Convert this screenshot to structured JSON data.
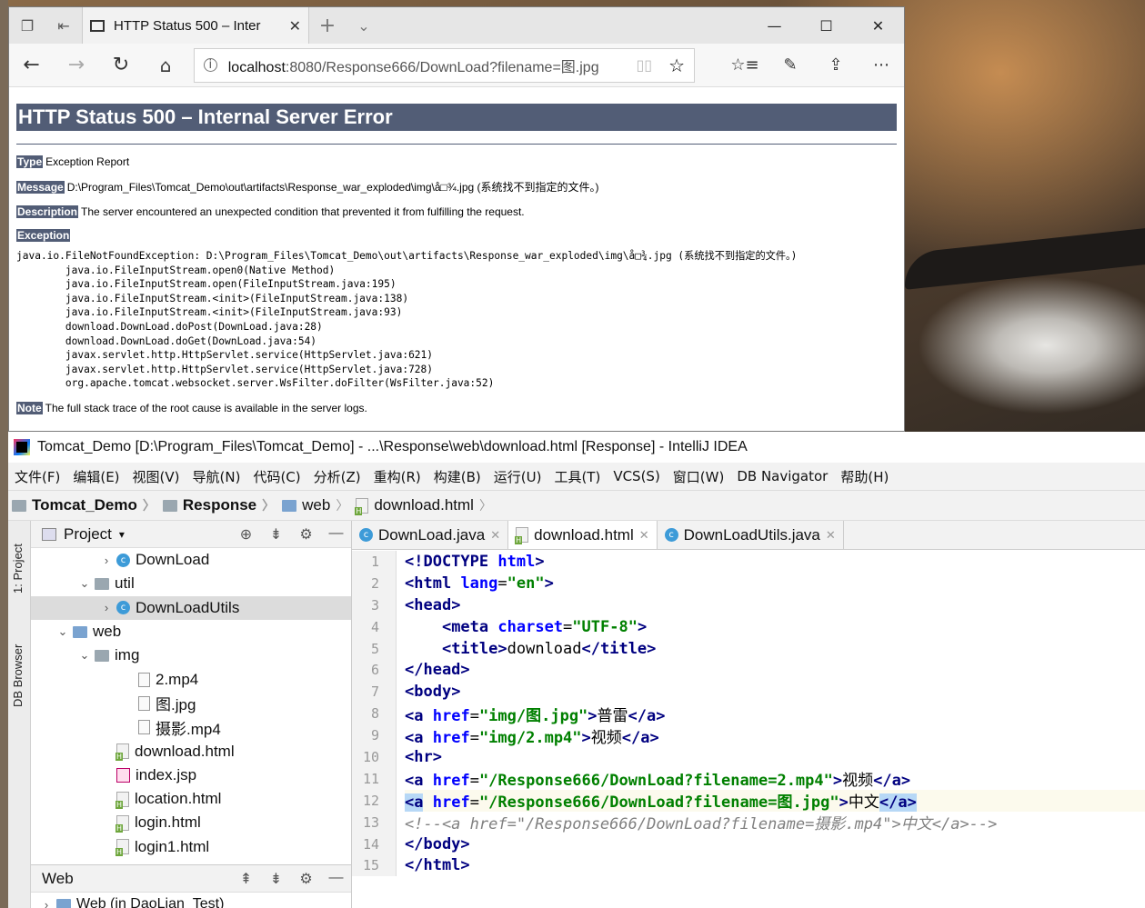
{
  "browser": {
    "tab_title": "HTTP Status 500 – Inter",
    "url_host": "localhost",
    "url_rest": ":8080/Response666/DownLoad?filename=图.jpg"
  },
  "error_page": {
    "heading": "HTTP Status 500 – Internal Server Error",
    "type_label": "Type",
    "type_value": "Exception Report",
    "message_label": "Message",
    "message_value": "D:\\Program_Files\\Tomcat_Demo\\out\\artifacts\\Response_war_exploded\\img\\å□¾.jpg (系统找不到指定的文件。)",
    "description_label": "Description",
    "description_value": "The server encountered an unexpected condition that prevented it from fulfilling the request.",
    "exception_label": "Exception",
    "stack_trace": [
      "java.io.FileNotFoundException: D:\\Program_Files\\Tomcat_Demo\\out\\artifacts\\Response_war_exploded\\img\\å□¾.jpg (系统找不到指定的文件。)",
      "\tjava.io.FileInputStream.open0(Native Method)",
      "\tjava.io.FileInputStream.open(FileInputStream.java:195)",
      "\tjava.io.FileInputStream.<init>(FileInputStream.java:138)",
      "\tjava.io.FileInputStream.<init>(FileInputStream.java:93)",
      "\tdownload.DownLoad.doPost(DownLoad.java:28)",
      "\tdownload.DownLoad.doGet(DownLoad.java:54)",
      "\tjavax.servlet.http.HttpServlet.service(HttpServlet.java:621)",
      "\tjavax.servlet.http.HttpServlet.service(HttpServlet.java:728)",
      "\torg.apache.tomcat.websocket.server.WsFilter.doFilter(WsFilter.java:52)"
    ],
    "note_label": "Note",
    "note_value": "The full stack trace of the root cause is available in the server logs."
  },
  "ide": {
    "title": "Tomcat_Demo [D:\\Program_Files\\Tomcat_Demo] - ...\\Response\\web\\download.html [Response] - IntelliJ IDEA",
    "menu": [
      "文件(F)",
      "编辑(E)",
      "视图(V)",
      "导航(N)",
      "代码(C)",
      "分析(Z)",
      "重构(R)",
      "构建(B)",
      "运行(U)",
      "工具(T)",
      "VCS(S)",
      "窗口(W)",
      "DB Navigator",
      "帮助(H)"
    ],
    "breadcrumbs": [
      "Tomcat_Demo",
      "Response",
      "web",
      "download.html"
    ],
    "side_tabs": [
      "1: Project",
      "DB Browser"
    ],
    "project_panel_title": "Project",
    "tree": [
      {
        "label": "DownLoad",
        "kind": "class",
        "depth": 4,
        "arrow": "›"
      },
      {
        "label": "util",
        "kind": "folder",
        "depth": 3,
        "arrow": "⌄"
      },
      {
        "label": "DownLoadUtils",
        "kind": "class",
        "depth": 4,
        "arrow": "›"
      },
      {
        "label": "web",
        "kind": "folder-blue",
        "depth": 2,
        "arrow": "⌄"
      },
      {
        "label": "img",
        "kind": "folder",
        "depth": 3,
        "arrow": "⌄"
      },
      {
        "label": "2.mp4",
        "kind": "file",
        "depth": 5,
        "arrow": ""
      },
      {
        "label": "图.jpg",
        "kind": "file",
        "depth": 5,
        "arrow": ""
      },
      {
        "label": "摄影.mp4",
        "kind": "file",
        "depth": 5,
        "arrow": ""
      },
      {
        "label": "download.html",
        "kind": "html",
        "depth": 4,
        "arrow": ""
      },
      {
        "label": "index.jsp",
        "kind": "jsp",
        "depth": 4,
        "arrow": ""
      },
      {
        "label": "location.html",
        "kind": "html",
        "depth": 4,
        "arrow": ""
      },
      {
        "label": "login.html",
        "kind": "html",
        "depth": 4,
        "arrow": ""
      },
      {
        "label": "login1.html",
        "kind": "html",
        "depth": 4,
        "arrow": ""
      }
    ],
    "web_panel_title": "Web",
    "web_panel_item": "Web (in DaoLian_Test)",
    "editor_tabs": [
      "DownLoad.java",
      "download.html",
      "DownLoadUtils.java"
    ],
    "line_numbers": [
      "1",
      "2",
      "3",
      "4",
      "5",
      "6",
      "7",
      "8",
      "9",
      "10",
      "11",
      "12",
      "13",
      "14",
      "15"
    ],
    "code": [
      "<!DOCTYPE html>",
      "<html lang=\"en\">",
      "<head>",
      "    <meta charset=\"UTF-8\">",
      "    <title>download</title>",
      "</head>",
      "<body>",
      "<a href=\"img/图.jpg\">普雷</a>",
      "<a href=\"img/2.mp4\">视频</a>",
      "<hr>",
      "<a href=\"/Response666/DownLoad?filename=2.mp4\">视频</a>",
      "<a href=\"/Response666/DownLoad?filename=图.jpg\">中文</a>",
      "<!--<a href=\"/Response666/DownLoad?filename=摄影.mp4\">中文</a>-->",
      "</body>",
      "</html>"
    ]
  }
}
